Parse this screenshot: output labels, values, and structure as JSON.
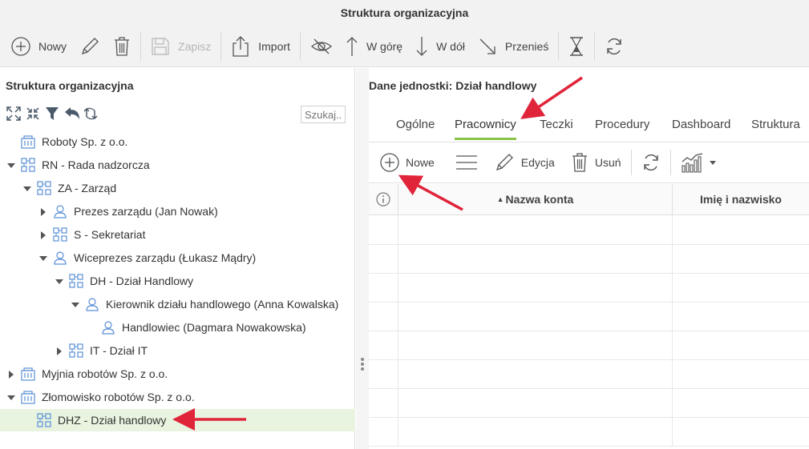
{
  "window": {
    "title": "Struktura organizacyjna"
  },
  "toolbar": {
    "new_label": "Nowy",
    "save_label": "Zapisz",
    "import_label": "Import",
    "up_label": "W górę",
    "down_label": "W dół",
    "move_label": "Przenieś",
    "save_disabled": true
  },
  "left_panel": {
    "title": "Struktura organizacyjna",
    "search_placeholder": "Szukaj...",
    "tree": [
      {
        "label": "Roboty Sp. z o.o.",
        "type": "company",
        "expander": "none",
        "level": 0
      },
      {
        "label": "RN - Rada nadzorcza",
        "type": "unit",
        "expander": "expanded",
        "level": 0
      },
      {
        "label": "ZA - Zarząd",
        "type": "unit",
        "expander": "expanded",
        "level": 1
      },
      {
        "label": "Prezes zarządu (Jan Nowak)",
        "type": "person",
        "expander": "collapsed",
        "level": 2
      },
      {
        "label": "S - Sekretariat",
        "type": "unit",
        "expander": "collapsed",
        "level": 2
      },
      {
        "label": "Wiceprezes zarządu (Łukasz Mądry)",
        "type": "person",
        "expander": "expanded",
        "level": 2
      },
      {
        "label": "DH - Dział Handlowy",
        "type": "unit",
        "expander": "expanded",
        "level": 3
      },
      {
        "label": "Kierownik działu handlowego (Anna Kowalska)",
        "type": "person",
        "expander": "expanded",
        "level": 4
      },
      {
        "label": "Handlowiec (Dagmara Nowakowska)",
        "type": "person",
        "expander": "none",
        "level": 5
      },
      {
        "label": "IT - Dział IT",
        "type": "unit",
        "expander": "collapsed",
        "level": 3
      },
      {
        "label": "Myjnia robotów Sp. z o.o.",
        "type": "company",
        "expander": "collapsed",
        "level": 0
      },
      {
        "label": "Złomowisko robotów Sp. z o.o.",
        "type": "company",
        "expander": "expanded",
        "level": 0
      },
      {
        "label": "DHZ - Dział handlowy",
        "type": "unit",
        "expander": "none",
        "level": 1,
        "selected": true
      }
    ]
  },
  "right_panel": {
    "unit_title_prefix": "Dane jednostki:",
    "unit_title_value": "Dział handlowy",
    "tabs": [
      {
        "label": "Ogólne"
      },
      {
        "label": "Pracownicy",
        "active": true
      },
      {
        "label": "Teczki"
      },
      {
        "label": "Procedury"
      },
      {
        "label": "Dashboard"
      },
      {
        "label": "Struktura"
      }
    ],
    "sub_toolbar": {
      "new_label": "Nowe",
      "edit_label": "Edycja",
      "delete_label": "Usuń"
    },
    "grid": {
      "col_account": "Nazwa konta",
      "col_name": "Imię i nazwisko",
      "sort_indicator": "▲"
    }
  },
  "colors": {
    "accent": "#8bc34a",
    "selected_row": "#e8f4e0",
    "icon_blue": "#5a8fd6",
    "annotation_arrow": "#e0243a"
  }
}
